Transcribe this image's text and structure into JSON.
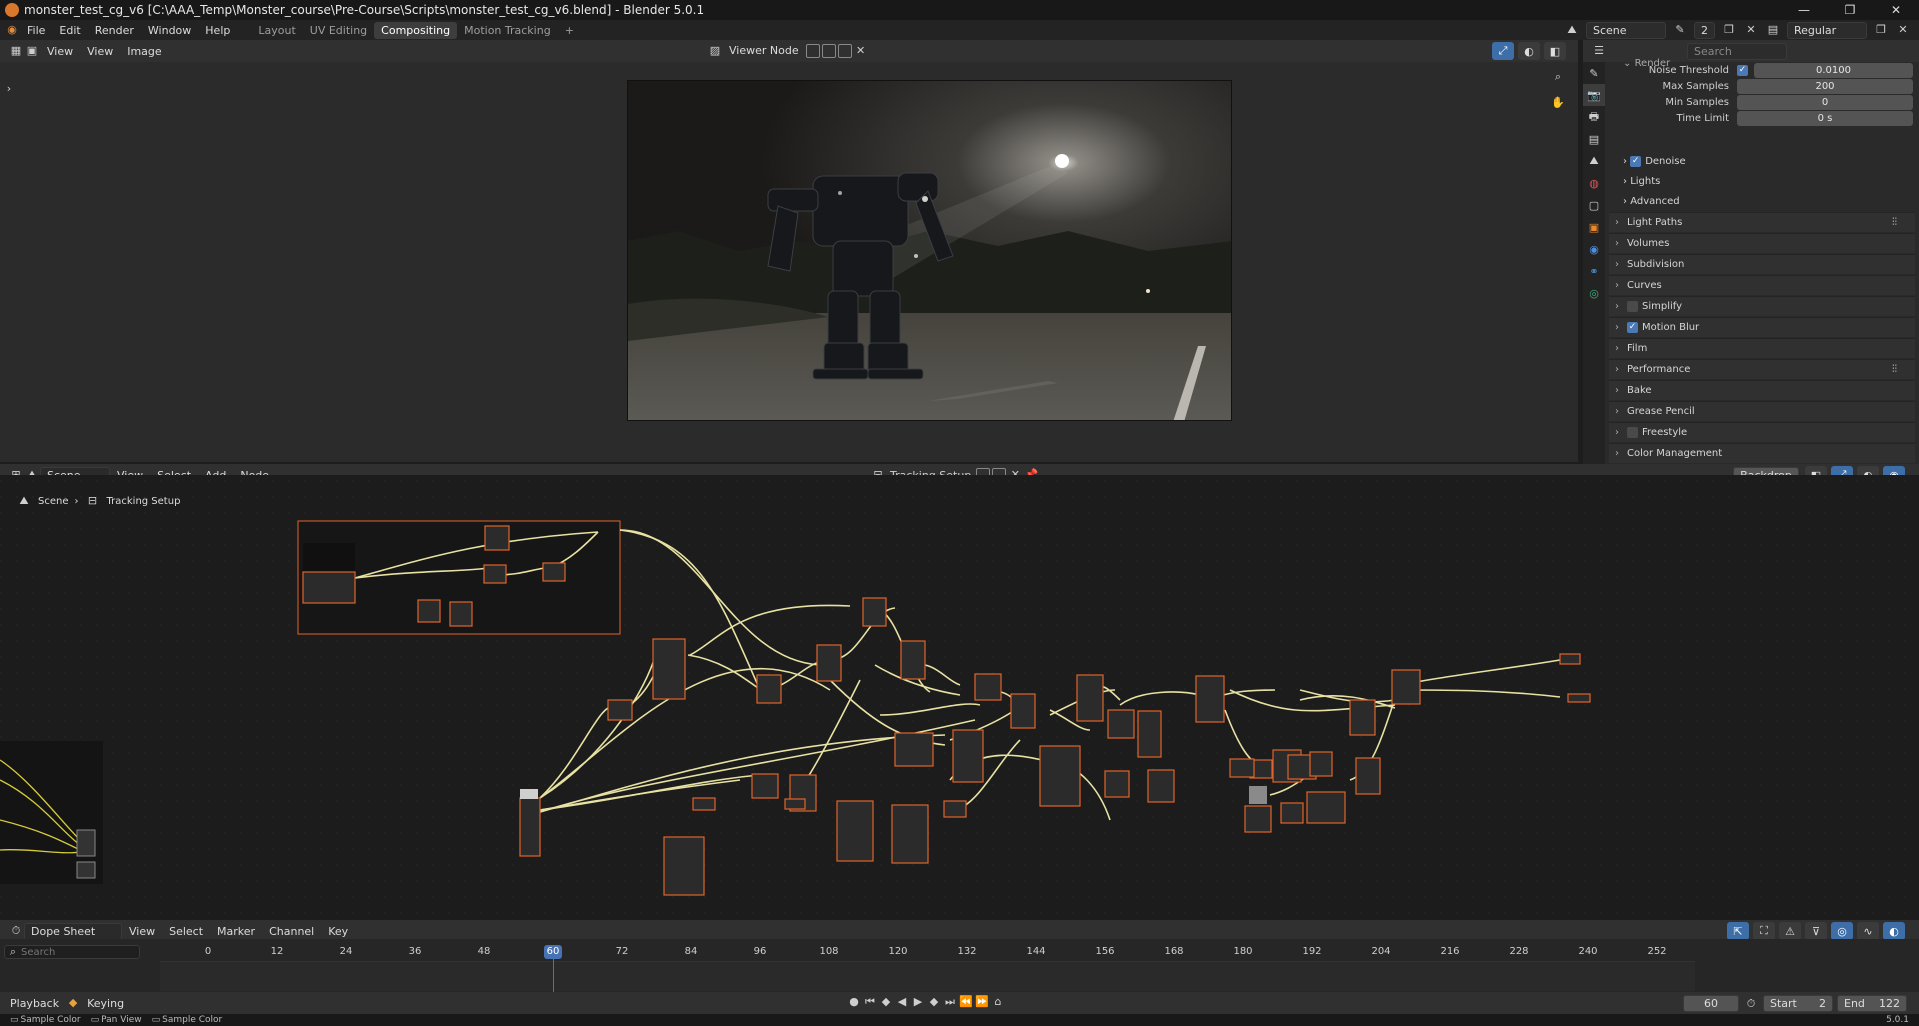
{
  "window": {
    "title": "monster_test_cg_v6 [C:\\AAA_Temp\\Monster_course\\Pre-Course\\Scripts\\monster_test_cg_v6.blend] - Blender 5.0.1",
    "controls": [
      "—",
      "❐",
      "✕"
    ]
  },
  "menubar": {
    "items": [
      "File",
      "Edit",
      "Render",
      "Window",
      "Help"
    ],
    "workspaces": [
      "Layout",
      "UV Editing",
      "Compositing",
      "Motion Tracking"
    ],
    "active_workspace": "Compositing",
    "add_tab": "+",
    "scene": "Scene",
    "scene_users": "2",
    "view_layer": "Regular"
  },
  "image_editor": {
    "menus": [
      "View",
      "View",
      "Image"
    ],
    "image_name": "Viewer Node"
  },
  "properties": {
    "search_placeholder": "Search",
    "section_render": "Render",
    "fields": [
      {
        "label": "Noise Threshold",
        "value": "0.0100",
        "checkbox": true
      },
      {
        "label": "Max Samples",
        "value": "200"
      },
      {
        "label": "Min Samples",
        "value": "0"
      },
      {
        "label": "Time Limit",
        "value": "0 s"
      }
    ],
    "subpanels": [
      {
        "label": "Denoise",
        "checkbox": true
      },
      {
        "label": "Lights"
      },
      {
        "label": "Advanced"
      }
    ],
    "panels": [
      {
        "label": "Light Paths",
        "checkbox": null
      },
      {
        "label": "Volumes",
        "checkbox": null
      },
      {
        "label": "Subdivision",
        "checkbox": null
      },
      {
        "label": "Curves",
        "checkbox": null
      },
      {
        "label": "Simplify",
        "checkbox": false
      },
      {
        "label": "Motion Blur",
        "checkbox": true
      },
      {
        "label": "Film",
        "checkbox": null
      },
      {
        "label": "Performance",
        "checkbox": null
      },
      {
        "label": "Bake",
        "checkbox": null
      },
      {
        "label": "Grease Pencil",
        "checkbox": null
      },
      {
        "label": "Freestyle",
        "checkbox": false
      },
      {
        "label": "Color Management",
        "checkbox": null
      }
    ]
  },
  "node_editor": {
    "editor_type": "Scene",
    "menus": [
      "View",
      "Select",
      "Add",
      "Node"
    ],
    "node_tree": "Tracking Setup",
    "backdrop_label": "Backdrop",
    "breadcrumb": [
      "Scene",
      "Tracking Setup"
    ]
  },
  "dope_sheet": {
    "mode": "Dope Sheet",
    "menus": [
      "View",
      "Select",
      "Marker",
      "Channel",
      "Key"
    ],
    "search_placeholder": "Search",
    "ticks": [
      "0",
      "12",
      "24",
      "36",
      "48",
      "60",
      "72",
      "84",
      "96",
      "108",
      "120",
      "132",
      "144",
      "156",
      "168",
      "180",
      "192",
      "204",
      "216",
      "228",
      "240",
      "252"
    ],
    "current_frame": "60"
  },
  "playback": {
    "playback_label": "Playback",
    "keying_label": "Keying",
    "frame": "60",
    "start_label": "Start",
    "start_value": "2",
    "end_label": "End",
    "end_value": "122"
  },
  "statusbar": {
    "items": [
      "Sample Color",
      "Pan View",
      "Sample Color"
    ],
    "version": "5.0.1"
  },
  "colors": {
    "accent": "#4772b3",
    "node_outline": "#e0642a",
    "noodle": "#e8e2a2"
  }
}
